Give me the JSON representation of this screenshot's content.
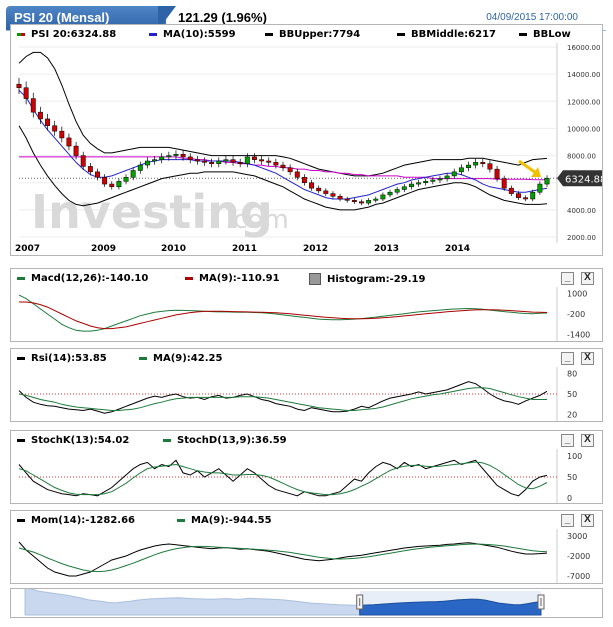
{
  "header": {
    "tab_title": "PSI 20 (Mensal)",
    "price": "121.29 (1.96%)",
    "datetime": "04/09/2015 17:00:00"
  },
  "colors": {
    "up": "#00a000",
    "down": "#d00000",
    "ma": "#2222cc",
    "bb": "#000000",
    "bbmid": "#cc00cc",
    "macd_ma": "#aa0000",
    "signal": "#1e7a3c"
  },
  "main_legend": {
    "ohlc": "PSI 20:6324.88",
    "ma": "MA(10):5599",
    "bb_upper": "BBUpper:7794",
    "bb_middle": "BBMiddle:6217",
    "bb_low": "BBLow"
  },
  "price_label": "6324.88",
  "watermark": {
    "brand": "Investing",
    "suffix": ".com"
  },
  "macd_legend": {
    "macd": "Macd(12,26):-140.10",
    "ma": "MA(9):-110.91",
    "hist": "Histogram:-29.19"
  },
  "rsi_legend": {
    "rsi": "Rsi(14):53.85",
    "ma": "MA(9):42.25"
  },
  "stoch_legend": {
    "k": "StochK(13):54.02",
    "d": "StochD(13,9):36.59"
  },
  "mom_legend": {
    "mom": "Mom(14):-1282.66",
    "ma": "MA(9):-944.55"
  },
  "buttons": {
    "minimize": "_",
    "close": "X"
  },
  "chart_data": [
    {
      "type": "candlestick",
      "title": "PSI 20 (Mensal)",
      "x_labels": [
        "2007",
        "2009",
        "2010",
        "2011",
        "2012",
        "2013",
        "2014"
      ],
      "y_ticks": [
        "16000.00",
        "14000.00",
        "12000.00",
        "10000.00",
        "8000.00",
        "6000.00",
        "4000.00",
        "2000.00"
      ],
      "ylim": [
        2000,
        16000
      ],
      "close": [
        13000,
        12200,
        11200,
        10700,
        10200,
        9800,
        9300,
        8700,
        8000,
        7200,
        6800,
        6400,
        5900,
        5700,
        6100,
        6400,
        6900,
        7300,
        7600,
        7700,
        7900,
        8000,
        8100,
        7900,
        7700,
        7600,
        7500,
        7400,
        7600,
        7700,
        7500,
        7400,
        7900,
        7700,
        7600,
        7500,
        7300,
        7100,
        6800,
        6400,
        6000,
        5600,
        5400,
        5200,
        5000,
        4800,
        4700,
        4600,
        4500,
        4700,
        4800,
        5100,
        5300,
        5500,
        5700,
        5900,
        6000,
        6100,
        6200,
        6300,
        6500,
        6800,
        7100,
        7300,
        7500,
        7400,
        7000,
        6300,
        5600,
        5200,
        4900,
        4800,
        5300,
        5900,
        6325
      ],
      "ma": [
        12800,
        12300,
        11400,
        10600,
        9900,
        9300,
        8700,
        8100,
        7500,
        7000,
        6600,
        6400,
        6400,
        6500,
        6700,
        6900,
        7100,
        7300,
        7500,
        7600,
        7700,
        7700,
        7700,
        7700,
        7700,
        7600,
        7600,
        7600,
        7600,
        7600,
        7600,
        7500,
        7400,
        7300,
        7100,
        6900,
        6700,
        6400,
        6100,
        5800,
        5500,
        5300,
        5100,
        4900,
        4800,
        4800,
        4800,
        4900,
        5000,
        5100,
        5300,
        5500,
        5700,
        5900,
        6000,
        6200,
        6300,
        6400,
        6500,
        6600,
        6700,
        6700,
        6600,
        6400,
        6200,
        5900,
        5700,
        5600,
        5500,
        5400,
        5300,
        5300,
        5400,
        5500,
        5599
      ],
      "bb_upper": [
        14800,
        15300,
        15600,
        15600,
        15200,
        14400,
        13200,
        11800,
        10500,
        9500,
        8900,
        8500,
        8200,
        8200,
        8300,
        8400,
        8500,
        8600,
        8600,
        8600,
        8600,
        8600,
        8500,
        8400,
        8300,
        8200,
        8100,
        8000,
        8000,
        8000,
        8000,
        8000,
        8000,
        8000,
        8000,
        8000,
        8000,
        7900,
        7800,
        7600,
        7400,
        7200,
        7000,
        6900,
        6800,
        6700,
        6600,
        6500,
        6500,
        6500,
        6600,
        6700,
        6900,
        7100,
        7300,
        7400,
        7500,
        7600,
        7700,
        7700,
        7700,
        7700,
        7700,
        7800,
        7800,
        7800,
        7700,
        7600,
        7500,
        7400,
        7300,
        7500,
        7700,
        7750,
        7794
      ],
      "bb_middle": [
        7900,
        7900,
        7900,
        7900,
        7900,
        7900,
        7900,
        7900,
        7900,
        7900,
        7900,
        7900,
        7900,
        7900,
        7900,
        7900,
        7900,
        7900,
        7900,
        7900,
        7900,
        7900,
        7900,
        7800,
        7800,
        7700,
        7700,
        7600,
        7600,
        7500,
        7500,
        7400,
        7400,
        7300,
        7300,
        7200,
        7200,
        7100,
        7100,
        7000,
        7000,
        6900,
        6900,
        6800,
        6800,
        6700,
        6700,
        6600,
        6600,
        6500,
        6500,
        6500,
        6500,
        6500,
        6400,
        6400,
        6400,
        6400,
        6300,
        6300,
        6300,
        6300,
        6300,
        6300,
        6300,
        6300,
        6300,
        6250,
        6250,
        6250,
        6250,
        6250,
        6230,
        6220,
        6217
      ],
      "bb_low": [
        10200,
        9300,
        8200,
        7300,
        6500,
        5800,
        5200,
        4700,
        4400,
        4300,
        4400,
        4500,
        4700,
        4900,
        5100,
        5300,
        5500,
        5700,
        5900,
        6100,
        6300,
        6400,
        6500,
        6600,
        6700,
        6700,
        6800,
        6800,
        6800,
        6800,
        6800,
        6700,
        6600,
        6500,
        6300,
        6100,
        5900,
        5700,
        5400,
        5100,
        4800,
        4600,
        4400,
        4200,
        4100,
        4000,
        4000,
        4000,
        4100,
        4200,
        4400,
        4500,
        4700,
        4900,
        5100,
        5300,
        5500,
        5600,
        5700,
        5800,
        5900,
        6000,
        6000,
        5900,
        5700,
        5400,
        5100,
        4900,
        4700,
        4600,
        4500,
        4400,
        4400,
        4400,
        4450
      ]
    },
    {
      "type": "line",
      "title": "Macd(12,26)",
      "y_ticks": [
        "1000",
        "-200",
        "-1400"
      ],
      "ylim": [
        -1600,
        1200
      ],
      "series": [
        {
          "name": "Macd(12,26)",
          "values": [
            900,
            700,
            400,
            100,
            -200,
            -500,
            -800,
            -1000,
            -1150,
            -1200,
            -1200,
            -1150,
            -1050,
            -900,
            -750,
            -600,
            -450,
            -300,
            -200,
            -100,
            -50,
            0,
            20,
            10,
            0,
            -20,
            -40,
            -60,
            -80,
            -80,
            -90,
            -100,
            -100,
            -110,
            -130,
            -160,
            -200,
            -250,
            -300,
            -350,
            -400,
            -450,
            -500,
            -520,
            -540,
            -540,
            -520,
            -500,
            -470,
            -430,
            -380,
            -330,
            -280,
            -230,
            -180,
            -130,
            -80,
            -40,
            0,
            30,
            60,
            90,
            110,
            120,
            110,
            80,
            30,
            -20,
            -60,
            -100,
            -140,
            -170,
            -180,
            -160,
            -140
          ]
        },
        {
          "name": "MA(9)",
          "values": [
            500,
            500,
            450,
            350,
            200,
            0,
            -200,
            -400,
            -600,
            -750,
            -900,
            -1000,
            -1050,
            -1050,
            -1000,
            -950,
            -850,
            -750,
            -650,
            -550,
            -450,
            -350,
            -250,
            -180,
            -120,
            -80,
            -50,
            -40,
            -40,
            -50,
            -60,
            -70,
            -80,
            -90,
            -100,
            -110,
            -130,
            -160,
            -190,
            -230,
            -270,
            -310,
            -350,
            -390,
            -420,
            -450,
            -470,
            -480,
            -480,
            -470,
            -450,
            -420,
            -390,
            -350,
            -310,
            -270,
            -230,
            -190,
            -150,
            -110,
            -70,
            -40,
            -10,
            20,
            40,
            50,
            50,
            40,
            20,
            0,
            -30,
            -60,
            -90,
            -100,
            -111
          ]
        }
      ]
    },
    {
      "type": "line",
      "title": "Rsi(14)",
      "y_ticks": [
        "80",
        "50",
        "20"
      ],
      "ylim": [
        15,
        85
      ],
      "series": [
        {
          "name": "Rsi(14)",
          "values": [
            55,
            45,
            38,
            35,
            33,
            32,
            30,
            28,
            27,
            26,
            28,
            25,
            22,
            24,
            28,
            32,
            36,
            40,
            44,
            47,
            45,
            48,
            50,
            46,
            44,
            45,
            42,
            46,
            48,
            44,
            45,
            48,
            50,
            46,
            42,
            40,
            36,
            34,
            32,
            28,
            26,
            30,
            28,
            26,
            24,
            24,
            25,
            28,
            32,
            30,
            35,
            40,
            44,
            46,
            48,
            50,
            53,
            50,
            52,
            54,
            56,
            60,
            64,
            68,
            65,
            58,
            50,
            44,
            40,
            38,
            35,
            40,
            44,
            48,
            54
          ]
        },
        {
          "name": "MA(9)",
          "values": [
            50,
            48,
            45,
            42,
            40,
            38,
            35,
            33,
            31,
            30,
            29,
            28,
            27,
            26,
            26,
            27,
            28,
            30,
            33,
            36,
            38,
            41,
            43,
            44,
            45,
            45,
            45,
            45,
            45,
            45,
            45,
            46,
            46,
            46,
            45,
            44,
            42,
            40,
            38,
            36,
            34,
            32,
            30,
            29,
            28,
            27,
            26,
            26,
            27,
            28,
            29,
            31,
            34,
            37,
            40,
            43,
            45,
            47,
            49,
            50,
            52,
            54,
            56,
            58,
            59,
            59,
            58,
            55,
            52,
            49,
            46,
            44,
            42,
            42,
            42
          ]
        }
      ]
    },
    {
      "type": "line",
      "title": "StochK(13)",
      "y_ticks": [
        "100",
        "50",
        "0"
      ],
      "ylim": [
        -5,
        110
      ],
      "series": [
        {
          "name": "StochK(13)",
          "values": [
            80,
            60,
            40,
            30,
            20,
            15,
            10,
            8,
            5,
            10,
            8,
            5,
            15,
            25,
            40,
            55,
            70,
            80,
            85,
            70,
            80,
            75,
            90,
            60,
            55,
            65,
            50,
            60,
            70,
            55,
            40,
            55,
            70,
            60,
            45,
            30,
            20,
            15,
            10,
            5,
            15,
            10,
            5,
            5,
            10,
            15,
            30,
            45,
            40,
            60,
            75,
            85,
            80,
            70,
            85,
            75,
            80,
            70,
            75,
            80,
            85,
            90,
            80,
            85,
            90,
            70,
            50,
            30,
            20,
            10,
            5,
            20,
            40,
            50,
            54
          ]
        },
        {
          "name": "StochD(13,9)",
          "values": [
            70,
            65,
            55,
            45,
            35,
            25,
            18,
            12,
            9,
            8,
            8,
            8,
            10,
            15,
            25,
            35,
            48,
            60,
            70,
            74,
            76,
            78,
            80,
            75,
            70,
            65,
            62,
            60,
            60,
            58,
            55,
            55,
            56,
            56,
            54,
            50,
            43,
            35,
            27,
            20,
            15,
            12,
            10,
            8,
            8,
            10,
            14,
            20,
            28,
            36,
            46,
            56,
            66,
            72,
            76,
            78,
            78,
            76,
            75,
            76,
            78,
            80,
            82,
            84,
            86,
            84,
            78,
            68,
            56,
            44,
            32,
            24,
            22,
            28,
            37
          ]
        }
      ]
    },
    {
      "type": "line",
      "title": "Mom(14)",
      "y_ticks": [
        "3000",
        "-2000",
        "-7000"
      ],
      "ylim": [
        -8000,
        4000
      ],
      "series": [
        {
          "name": "Mom(14)",
          "values": [
            1500,
            -500,
            -2000,
            -3500,
            -5000,
            -6000,
            -6500,
            -7000,
            -7000,
            -6500,
            -6000,
            -5000,
            -4000,
            -3000,
            -2500,
            -2000,
            -1200,
            -500,
            0,
            500,
            800,
            1000,
            800,
            600,
            400,
            200,
            0,
            -200,
            0,
            100,
            -100,
            -300,
            -200,
            -400,
            -600,
            -800,
            -1200,
            -1600,
            -2000,
            -2400,
            -2800,
            -3000,
            -3200,
            -3000,
            -2800,
            -2500,
            -2200,
            -2000,
            -1800,
            -1500,
            -1200,
            -900,
            -600,
            -300,
            0,
            200,
            400,
            500,
            600,
            700,
            900,
            1000,
            1200,
            1300,
            1100,
            800,
            500,
            200,
            -300,
            -800,
            -1200,
            -1500,
            -1500,
            -1400,
            -1283
          ]
        },
        {
          "name": "MA(9)",
          "values": [
            0,
            -500,
            -1000,
            -1700,
            -2500,
            -3200,
            -3900,
            -4500,
            -5000,
            -5500,
            -5800,
            -5900,
            -5800,
            -5500,
            -5000,
            -4400,
            -3800,
            -3100,
            -2400,
            -1700,
            -1100,
            -600,
            -200,
            100,
            300,
            400,
            400,
            300,
            200,
            100,
            0,
            -100,
            -200,
            -300,
            -400,
            -550,
            -700,
            -900,
            -1100,
            -1400,
            -1700,
            -2000,
            -2300,
            -2500,
            -2700,
            -2750,
            -2700,
            -2600,
            -2400,
            -2200,
            -1900,
            -1600,
            -1300,
            -1000,
            -700,
            -400,
            -150,
            50,
            250,
            400,
            550,
            700,
            850,
            950,
            1000,
            950,
            850,
            700,
            500,
            200,
            -100,
            -400,
            -700,
            -850,
            -945
          ]
        }
      ]
    }
  ]
}
